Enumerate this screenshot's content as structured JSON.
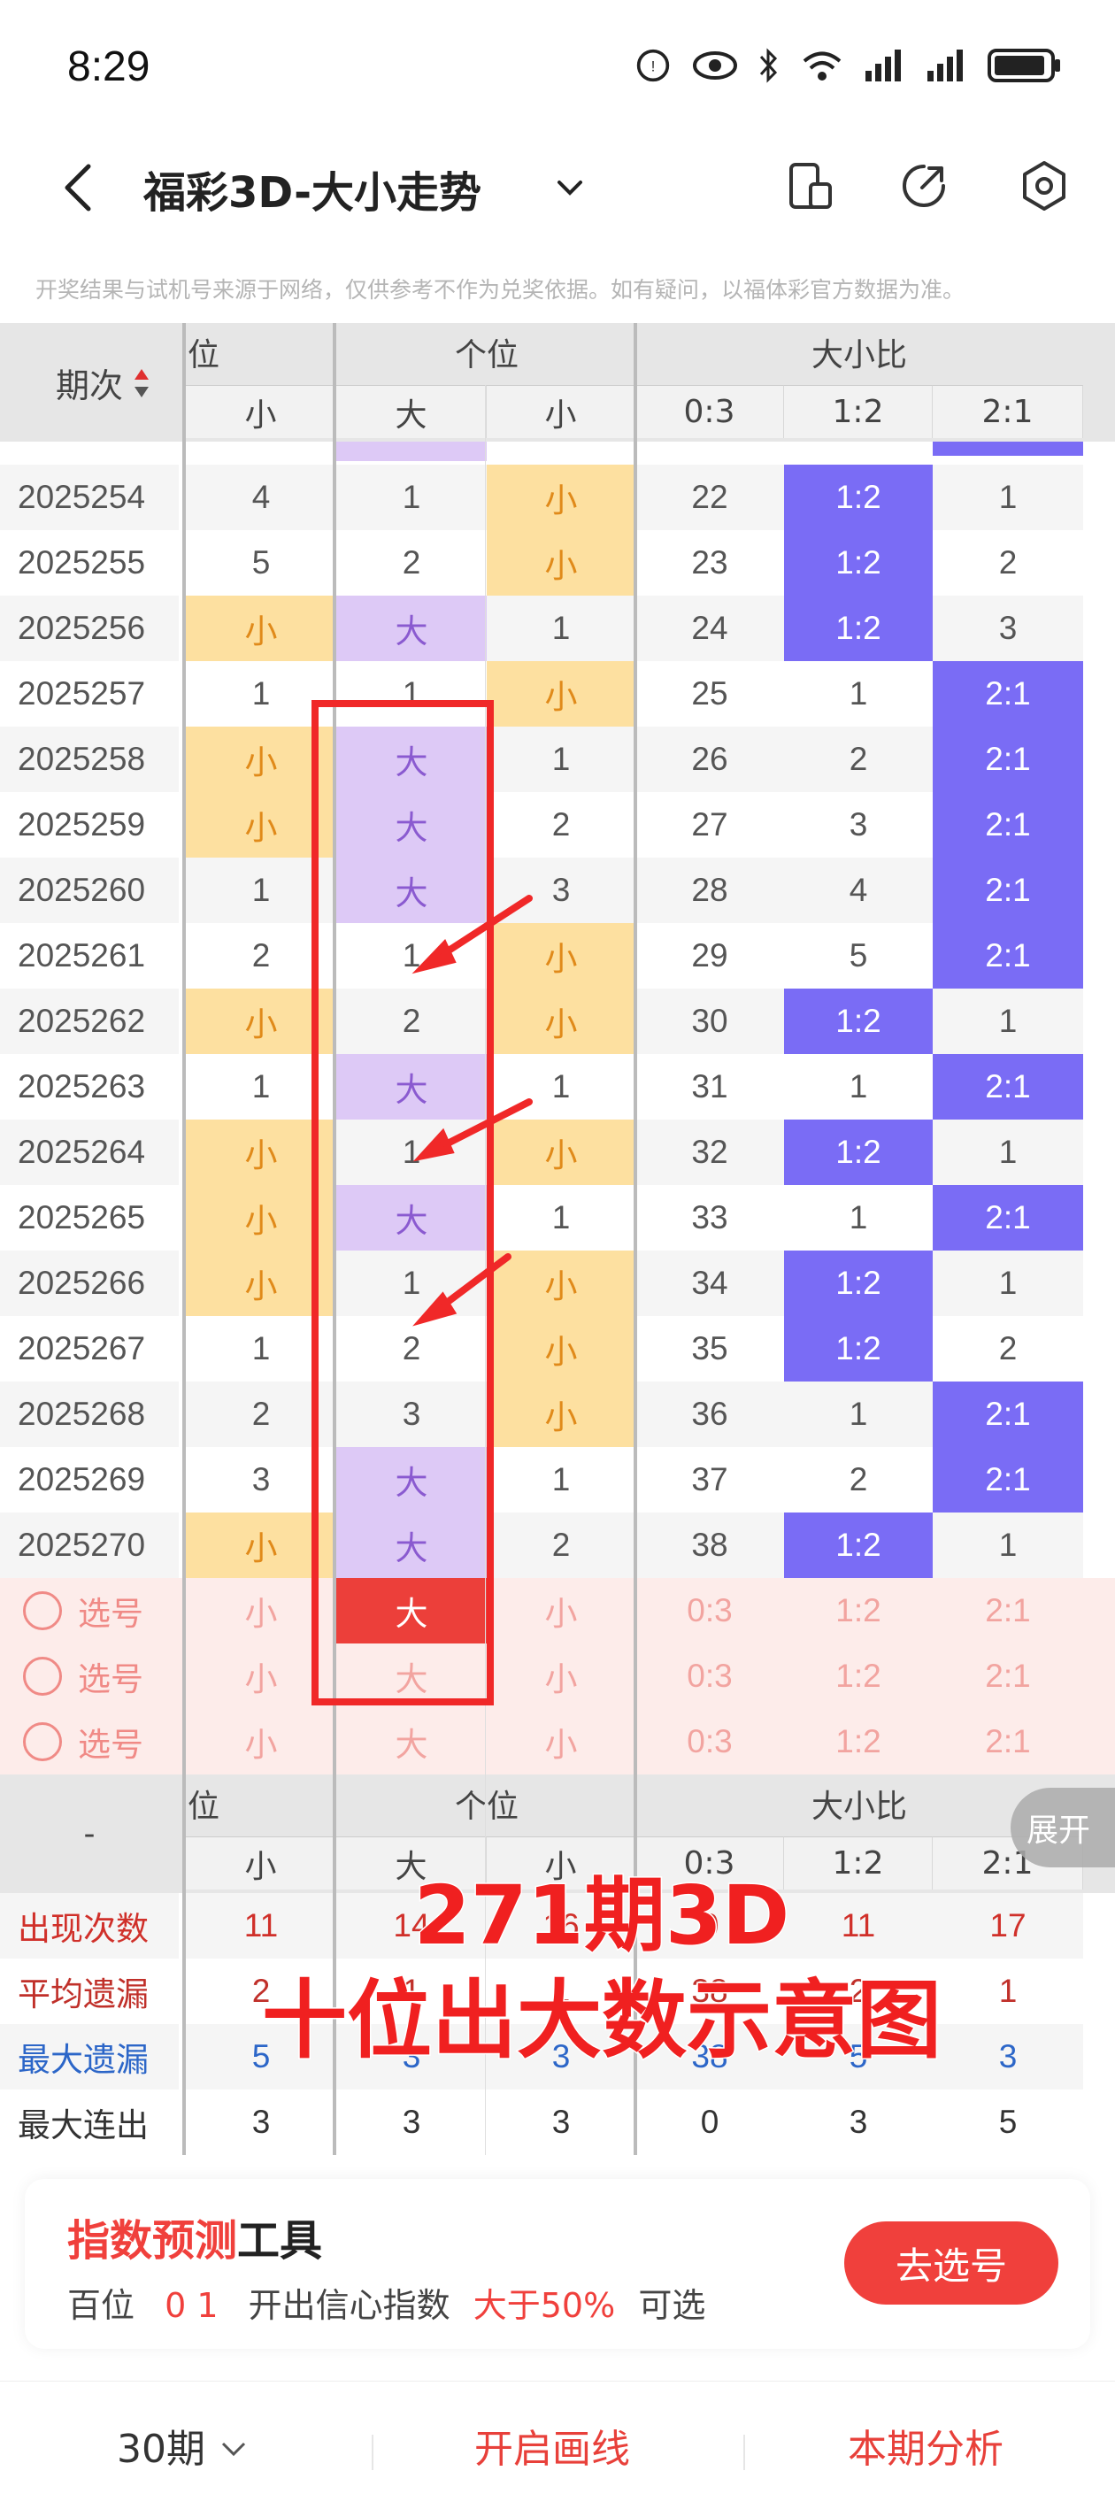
{
  "status": {
    "time": "8:29"
  },
  "nav": {
    "title": "福彩3D-大小走势"
  },
  "disclaimer": "开奖结果与试机号来源于网络，仅供参考不作为兑奖依据。如有疑问，以福体彩官方数据为准。",
  "table": {
    "issue_header": "期次",
    "group_prev": "位",
    "group_ones": "个位",
    "group_ratio": "大小比",
    "sub_headers": [
      "小",
      "大",
      "小",
      "0:3",
      "1:2",
      "2:1"
    ],
    "rows": [
      {
        "issue": "2025254",
        "c": [
          "4",
          "1",
          "小",
          "22",
          "1:2",
          "1"
        ],
        "hl": [
          0,
          0,
          1,
          0,
          2,
          0
        ]
      },
      {
        "issue": "2025255",
        "c": [
          "5",
          "2",
          "小",
          "23",
          "1:2",
          "2"
        ],
        "hl": [
          0,
          0,
          1,
          0,
          2,
          0
        ]
      },
      {
        "issue": "2025256",
        "c": [
          "小",
          "大",
          "1",
          "24",
          "1:2",
          "3"
        ],
        "hl": [
          1,
          3,
          0,
          0,
          2,
          0
        ]
      },
      {
        "issue": "2025257",
        "c": [
          "1",
          "1",
          "小",
          "25",
          "1",
          "2:1"
        ],
        "hl": [
          0,
          0,
          1,
          0,
          0,
          2
        ]
      },
      {
        "issue": "2025258",
        "c": [
          "小",
          "大",
          "1",
          "26",
          "2",
          "2:1"
        ],
        "hl": [
          1,
          3,
          0,
          0,
          0,
          2
        ]
      },
      {
        "issue": "2025259",
        "c": [
          "小",
          "大",
          "2",
          "27",
          "3",
          "2:1"
        ],
        "hl": [
          1,
          3,
          0,
          0,
          0,
          2
        ]
      },
      {
        "issue": "2025260",
        "c": [
          "1",
          "大",
          "3",
          "28",
          "4",
          "2:1"
        ],
        "hl": [
          0,
          3,
          0,
          0,
          0,
          2
        ]
      },
      {
        "issue": "2025261",
        "c": [
          "2",
          "1",
          "小",
          "29",
          "5",
          "2:1"
        ],
        "hl": [
          0,
          0,
          1,
          0,
          0,
          2
        ]
      },
      {
        "issue": "2025262",
        "c": [
          "小",
          "2",
          "小",
          "30",
          "1:2",
          "1"
        ],
        "hl": [
          1,
          0,
          1,
          0,
          2,
          0
        ]
      },
      {
        "issue": "2025263",
        "c": [
          "1",
          "大",
          "1",
          "31",
          "1",
          "2:1"
        ],
        "hl": [
          0,
          3,
          0,
          0,
          0,
          2
        ]
      },
      {
        "issue": "2025264",
        "c": [
          "小",
          "1",
          "小",
          "32",
          "1:2",
          "1"
        ],
        "hl": [
          1,
          0,
          1,
          0,
          2,
          0
        ]
      },
      {
        "issue": "2025265",
        "c": [
          "小",
          "大",
          "1",
          "33",
          "1",
          "2:1"
        ],
        "hl": [
          1,
          3,
          0,
          0,
          0,
          2
        ]
      },
      {
        "issue": "2025266",
        "c": [
          "小",
          "1",
          "小",
          "34",
          "1:2",
          "1"
        ],
        "hl": [
          1,
          0,
          1,
          0,
          2,
          0
        ]
      },
      {
        "issue": "2025267",
        "c": [
          "1",
          "2",
          "小",
          "35",
          "1:2",
          "2"
        ],
        "hl": [
          0,
          0,
          1,
          0,
          2,
          0
        ]
      },
      {
        "issue": "2025268",
        "c": [
          "2",
          "3",
          "小",
          "36",
          "1",
          "2:1"
        ],
        "hl": [
          0,
          0,
          1,
          0,
          0,
          2
        ]
      },
      {
        "issue": "2025269",
        "c": [
          "3",
          "大",
          "1",
          "37",
          "2",
          "2:1"
        ],
        "hl": [
          0,
          3,
          0,
          0,
          0,
          2
        ]
      },
      {
        "issue": "2025270",
        "c": [
          "小",
          "大",
          "2",
          "38",
          "1:2",
          "1"
        ],
        "hl": [
          1,
          3,
          0,
          0,
          2,
          0
        ]
      }
    ],
    "pick_label": "选号",
    "pick_cells": [
      "小",
      "大",
      "小",
      "0:3",
      "1:2",
      "2:1"
    ],
    "stats": [
      {
        "label": "出现次数",
        "v": [
          "11",
          "14",
          "16",
          "0",
          "11",
          "17"
        ],
        "color": "#d0302a"
      },
      {
        "label": "平均遗漏",
        "v": [
          "2",
          "1",
          "1",
          "38",
          "2",
          "1"
        ],
        "color": "#c0302a"
      },
      {
        "label": "最大遗漏",
        "v": [
          "5",
          "3",
          "3",
          "38",
          "5",
          "3"
        ],
        "color": "#2c66c8"
      },
      {
        "label": "最大连出",
        "v": [
          "3",
          "3",
          "3",
          "0",
          "3",
          "5"
        ],
        "color": "#333333"
      }
    ],
    "stats_dash": "-"
  },
  "overlay": {
    "line1": "271期3D",
    "line2": "十位出大数示意图"
  },
  "expand_label": "展开",
  "tool": {
    "title_red": "指数预测",
    "title_black": "工具",
    "desc_a": "百位",
    "desc_nums": "0 1",
    "desc_b": "开出信心指数",
    "desc_pct": "大于50%",
    "desc_c": "可选",
    "button": "去选号"
  },
  "bottom": {
    "periods": "30期",
    "draw": "开启画线",
    "analysis": "本期分析"
  },
  "colors": {
    "yellow": "#fde0a0",
    "yellow_text": "#e08a1a",
    "purple": "#ddc9f6",
    "purple_text": "#8a5ad0",
    "blue": "#7a6cf5",
    "red": "#f0403c"
  }
}
